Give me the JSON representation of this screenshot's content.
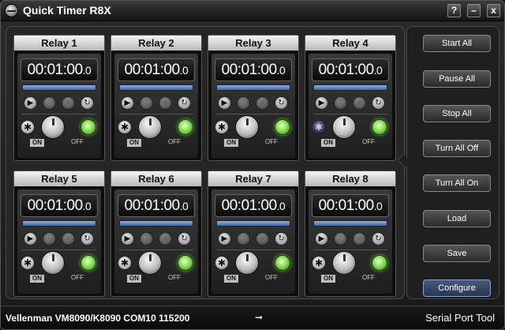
{
  "window": {
    "title": "Quick Timer R8X",
    "controls": {
      "help": "?",
      "minimize": "–",
      "close": "x"
    }
  },
  "relays": [
    {
      "name": "Relay 1",
      "time": "00:01:00",
      "tenths": ".0",
      "on_label": "ON",
      "off_label": "OFF"
    },
    {
      "name": "Relay 2",
      "time": "00:01:00",
      "tenths": ".0",
      "on_label": "ON",
      "off_label": "OFF"
    },
    {
      "name": "Relay 3",
      "time": "00:01:00",
      "tenths": ".0",
      "on_label": "ON",
      "off_label": "OFF"
    },
    {
      "name": "Relay 4",
      "time": "00:01:00",
      "tenths": ".0",
      "on_label": "ON",
      "off_label": "OFF"
    },
    {
      "name": "Relay 5",
      "time": "00:01:00",
      "tenths": ".0",
      "on_label": "ON",
      "off_label": "OFF"
    },
    {
      "name": "Relay 6",
      "time": "00:01:00",
      "tenths": ".0",
      "on_label": "ON",
      "off_label": "OFF"
    },
    {
      "name": "Relay 7",
      "time": "00:01:00",
      "tenths": ".0",
      "on_label": "ON",
      "off_label": "OFF"
    },
    {
      "name": "Relay 8",
      "time": "00:01:00",
      "tenths": ".0",
      "on_label": "ON",
      "off_label": "OFF"
    }
  ],
  "relay_icons": {
    "play": "▶",
    "pause": "‖",
    "stop": "■",
    "reset": "↻",
    "gear": "✱"
  },
  "side_buttons": {
    "start_all": "Start All",
    "pause_all": "Pause All",
    "stop_all": "Stop All",
    "turn_all_off": "Turn All Off",
    "turn_all_on": "Turn All On",
    "load": "Load",
    "save": "Save",
    "configure": "Configure"
  },
  "status": {
    "device": "Vellenman VM8090/K8090 COM10 115200",
    "arrow": "➞",
    "tool": "Serial Port Tool"
  },
  "colors": {
    "progress": "#5a82d0",
    "led_on": "#7ed84a",
    "header": "#d8d8d8"
  }
}
